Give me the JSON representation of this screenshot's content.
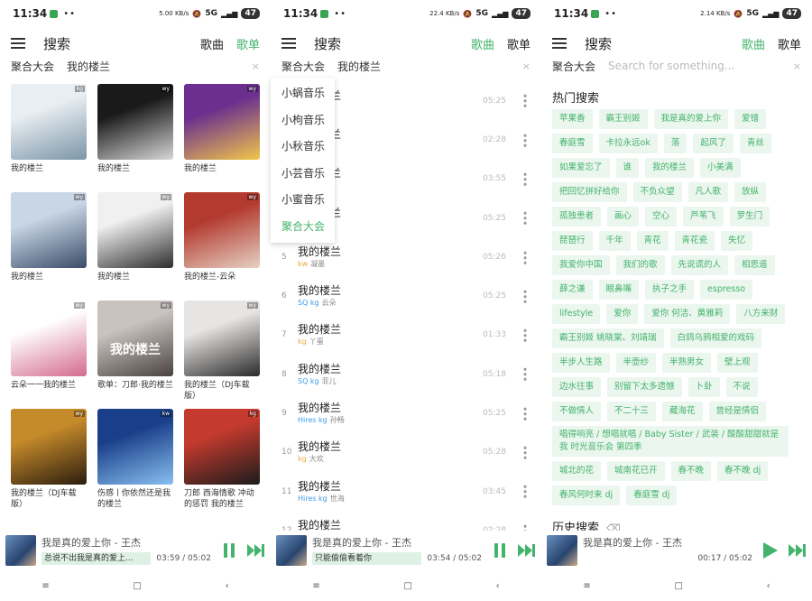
{
  "colors": {
    "accent": "#44b36b",
    "chip_bg": "#eaf6ee",
    "highlight": "#dff1e5"
  },
  "status": {
    "time": "11:34",
    "speed1": "5.00 KB/s",
    "speed2": "22.4 KB/s",
    "speed3": "2.14 KB/s",
    "signal": "5G",
    "battery": "47"
  },
  "header": {
    "title": "搜索",
    "tab_songs": "歌曲",
    "tab_playlists": "歌单"
  },
  "search": {
    "source": "聚合大会",
    "query": "我的楼兰",
    "placeholder": "Search for something...",
    "clear": "×"
  },
  "grid": [
    {
      "caption": "我的楼兰",
      "tag": "kg",
      "colors": [
        "#e9eef2",
        "#7b95a8"
      ]
    },
    {
      "caption": "我的楼兰",
      "tag": "wy",
      "colors": [
        "#1a1a1a",
        "#d8d8d8"
      ]
    },
    {
      "caption": "我的楼兰",
      "tag": "wy",
      "colors": [
        "#6a2f8f",
        "#f2c64a"
      ]
    },
    {
      "caption": "我的楼兰",
      "tag": "wy",
      "colors": [
        "#c8d6e6",
        "#3b4c67"
      ]
    },
    {
      "caption": "我的楼兰",
      "tag": "wy",
      "colors": [
        "#f0f0f0",
        "#2e2e2e"
      ]
    },
    {
      "caption": "我的楼兰-云朵",
      "tag": "wy",
      "colors": [
        "#b33a2f",
        "#e6d1c4"
      ]
    },
    {
      "caption": "云朵一一我的楼兰",
      "tag": "wy",
      "colors": [
        "#ffffff",
        "#d46a8f"
      ]
    },
    {
      "caption": "歌单：刀郎·我的楼兰",
      "tag": "wy",
      "colors": [
        "#c9c3c0",
        "#4a4340"
      ],
      "cover_text": "我的楼兰"
    },
    {
      "caption": "我的楼兰（DJ车载版）",
      "tag": "wy",
      "colors": [
        "#e7e5e3",
        "#2a2a2a"
      ]
    },
    {
      "caption": "我的楼兰（DJ车载版）",
      "tag": "wy",
      "colors": [
        "#c58a2a",
        "#2b1d0f"
      ]
    },
    {
      "caption": "伤感丨你依然还是我的楼兰",
      "tag": "kw",
      "colors": [
        "#1a3f8a",
        "#89c0ef"
      ]
    },
    {
      "caption": "刀郎 西海情歌 冲动的惩罚 我的楼兰",
      "tag": "kg",
      "colors": [
        "#c43a2e",
        "#1c1c1c"
      ]
    }
  ],
  "dropdown": [
    "小蜗音乐",
    "小枸音乐",
    "小秋音乐",
    "小芸音乐",
    "小蜜音乐",
    "聚合大会"
  ],
  "songs": [
    {
      "num": "1",
      "name": "我的楼兰",
      "quality": "",
      "artist": "",
      "dur": "05:25"
    },
    {
      "num": "2",
      "name": "我的楼兰",
      "quality": "",
      "artist": "",
      "dur": "02:28"
    },
    {
      "num": "3",
      "name": "我的楼兰",
      "quality": "",
      "artist": "",
      "dur": "03:55"
    },
    {
      "num": "4",
      "name": "我的楼兰",
      "quality": "",
      "artist": "",
      "dur": "05:25"
    },
    {
      "num": "5",
      "name": "我的楼兰",
      "quality": "kw",
      "artist": "凝墨",
      "dur": "05:26"
    },
    {
      "num": "6",
      "name": "我的楼兰",
      "quality": "SQ kg",
      "artist": "云朵",
      "dur": "05:25"
    },
    {
      "num": "7",
      "name": "我的楼兰",
      "quality": "kg",
      "artist": "丫蛋",
      "dur": "01:33"
    },
    {
      "num": "8",
      "name": "我的楼兰",
      "quality": "SQ kg",
      "artist": "菲儿",
      "dur": "05:18"
    },
    {
      "num": "9",
      "name": "我的楼兰",
      "quality": "Hires kg",
      "artist": "孙畅",
      "dur": "05:25"
    },
    {
      "num": "10",
      "name": "我的楼兰",
      "quality": "kg",
      "artist": "大欢",
      "dur": "05:28"
    },
    {
      "num": "11",
      "name": "我的楼兰",
      "quality": "Hires kg",
      "artist": "世海",
      "dur": "03:45"
    },
    {
      "num": "12",
      "name": "我的楼兰",
      "quality": "",
      "artist": "",
      "dur": "02:28"
    }
  ],
  "hot": {
    "title": "热门搜索",
    "history_title": "历史搜索",
    "tags": [
      "苹果香",
      "霸王别姬",
      "我是真的爱上你",
      "爱错",
      "春庭雪",
      "卡拉永远ok",
      "落",
      "起风了",
      "青丝",
      "如果爱忘了",
      "谁",
      "我的楼兰",
      "小美满",
      "把回忆拼好给你",
      "不负众望",
      "凡人歌",
      "放纵",
      "孤独患者",
      "画心",
      "空心",
      "芦苇飞",
      "罗生门",
      "琵琶行",
      "千年",
      "青花",
      "青花瓷",
      "失忆",
      "我爱你中国",
      "我们的歌",
      "先说谎的人",
      "相思遥",
      "薛之谦",
      "眼鼻嘴",
      "执子之手",
      "espresso",
      "lifestyle",
      "爱你",
      "爱你 何洁、黄雅莉",
      "八方来财",
      "霸王别姬 姚晓棠、刘靖瑞",
      "白鸽乌鸦相爱的戏码",
      "半步人生路",
      "半壶纱",
      "半熟男女",
      "壁上观",
      "边水往事",
      "别留下太多遗憾",
      "卜卦",
      "不说",
      "不做情人",
      "不二十三",
      "藏海花",
      "曾经是情侣",
      "唱得响亮 / 想唱就唱 / Baby Sister / 武装 / 酸酸甜甜就是我 时光音乐会 第四季",
      "城北的花",
      "城南花已开",
      "春不晚",
      "春不晚 dj",
      "春风何时来 dj",
      "春庭雪 dj"
    ]
  },
  "players": [
    {
      "title": "我是真的爱上你 - 王杰",
      "lyric": "总说不出我是真的爱上...",
      "time": "03:59 / 05:02"
    },
    {
      "title": "我是真的爱上你 - 王杰",
      "lyric": "只能偷偷看着你",
      "time": "03:54 / 05:02"
    },
    {
      "title": "我是真的爱上你 - 王杰",
      "lyric": "",
      "time": "00:17 / 05:02"
    }
  ],
  "nav": {
    "menu": "≡",
    "home": "□",
    "back": "‹"
  }
}
